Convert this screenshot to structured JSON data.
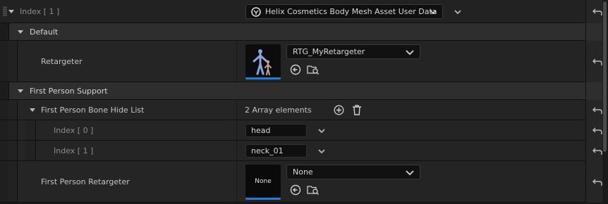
{
  "index_row": {
    "label": "Index [ 1 ]",
    "class_value": "Helix Cosmetics Body Mesh Asset User Data"
  },
  "default_category": {
    "label": "Default"
  },
  "retargeter": {
    "label": "Retargeter",
    "asset_value": "RTG_MyRetargeter"
  },
  "first_person_category": {
    "label": "First Person Support"
  },
  "bone_hide_list": {
    "label": "First Person Bone Hide List",
    "count_text": "2 Array elements",
    "elements": [
      {
        "label": "Index [ 0 ]",
        "value": "head"
      },
      {
        "label": "Index [ 1 ]",
        "value": "neck_01"
      }
    ]
  },
  "first_person_retargeter": {
    "label": "First Person Retargeter",
    "thumb_text": "None",
    "asset_value": "None"
  },
  "colors": {
    "accent": "#1f7de0",
    "background": "#1a1a1a",
    "category": "#2e2e2e"
  },
  "icons": [
    "grip-icon",
    "chevron-down-icon",
    "caret-down-icon",
    "unreal-class-icon",
    "reset-arrow-icon",
    "use-selected-icon",
    "browse-folder-icon",
    "add-circle-icon",
    "trash-icon"
  ]
}
